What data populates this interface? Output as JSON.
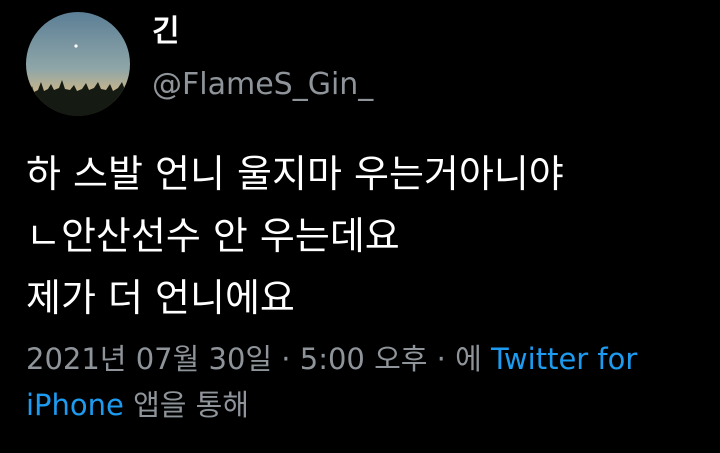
{
  "user": {
    "display_name": "긴",
    "handle": "@FlameS_Gin_",
    "avatar_icon": "night-sky-forest-avatar"
  },
  "tweet": {
    "lines": [
      "하 스발 언니 울지마 우는거아니야",
      "ㄴ안산선수 안 우는데요",
      "제가 더 언니에요"
    ]
  },
  "meta": {
    "date": "2021년 07월 30일",
    "separator1": " · ",
    "time": "5:00 오후",
    "separator2": " · ",
    "via_prefix": "에 ",
    "source_part1": "Twitter for",
    "source_part2": "iPhone",
    "via_suffix": " 앱을 통해"
  },
  "colors": {
    "background": "#000000",
    "text": "#ffffff",
    "secondary": "#8e9499",
    "link": "#1d9bf0"
  }
}
